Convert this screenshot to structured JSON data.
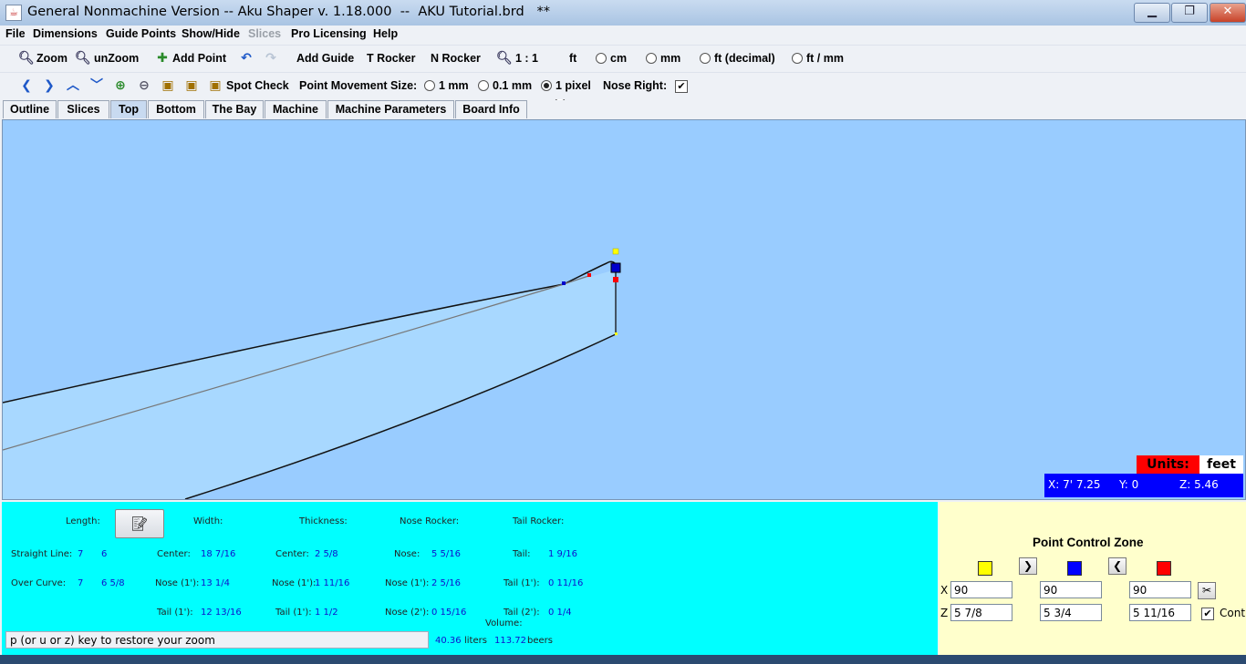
{
  "window": {
    "title": "General Nonmachine Version -- Aku Shaper v. 1.18.000  --  AKU Tutorial.brd   **",
    "minimize": "▁",
    "restore": "❐",
    "close": "✕"
  },
  "menu": [
    "File",
    "Dimensions",
    "Guide Points",
    "Show/Hide",
    "Slices",
    "Pro Licensing",
    "Help"
  ],
  "toolbar1": {
    "zoom": "Zoom",
    "unzoom": "unZoom",
    "add_point": "Add Point",
    "add_guide": "Add Guide",
    "t_rocker": "T Rocker",
    "n_rocker": "N Rocker",
    "scale": "1 : 1",
    "units": [
      "ft",
      "cm",
      "mm",
      "ft (decimal)",
      "ft / mm"
    ],
    "selected_unit": "ft"
  },
  "toolbar2": {
    "spot_check": "Spot Check",
    "point_movement_label": "Point Movement Size:",
    "sizes": [
      "1 mm",
      "0.1 mm",
      "1 pixel"
    ],
    "selected_size": "1 pixel",
    "nose_right_label": "Nose Right:",
    "nose_right": true
  },
  "tabs": [
    "Outline",
    "Slices",
    "Top",
    "Bottom",
    "The Bay",
    "Machine",
    "Machine Parameters",
    "Board Info"
  ],
  "active_tab": "Top",
  "canvas": {
    "units_label": "Units:",
    "units_value": "feet",
    "coords": {
      "x": "X: 7' 7.25",
      "y": "Y: 0",
      "z": "Z: 5.46"
    },
    "colors": {
      "background": "#99ccff",
      "fill": "#a8d8ff",
      "yellow": "#ffff00",
      "blue": "#0000cc",
      "red": "#ff0000"
    }
  },
  "info": {
    "headers": {
      "length": "Length:",
      "width": "Width:",
      "thickness": "Thickness:",
      "nose_rocker": "Nose Rocker:",
      "tail_rocker": "Tail Rocker:"
    },
    "straight_line": {
      "label": "Straight Line:",
      "ft": "7",
      "in": "6"
    },
    "over_curve": {
      "label": "Over Curve:",
      "ft": "7",
      "in": "6 5/8"
    },
    "width": {
      "center_label": "Center:",
      "center": "18 7/16",
      "nose1_label": "Nose (1'):",
      "nose1": "13 1/4",
      "tail1_label": "Tail (1'):",
      "tail1": "12 13/16"
    },
    "thickness": {
      "center_label": "Center:",
      "center": "2 5/8",
      "nose1_label": "Nose (1'):",
      "nose1": "1 11/16",
      "tail1_label": "Tail (1'):",
      "tail1": "1 1/2"
    },
    "nose_rocker": {
      "nose_label": "Nose:",
      "nose": "5 5/16",
      "nose1_label": "Nose (1'):",
      "nose1": "2 5/16",
      "nose2_label": "Nose (2'):",
      "nose2": "0 15/16"
    },
    "tail_rocker": {
      "tail_label": "Tail:",
      "tail": "1 9/16",
      "tail1_label": "Tail (1'):",
      "tail1": "0 11/16",
      "tail2_label": "Tail (2'):",
      "tail2": "0 1/4"
    },
    "volume_label": "Volume:",
    "liters": "40.36",
    "liters_label": "liters",
    "beers": "113.72",
    "beers_label": "beers",
    "status": "p (or u or z) key to restore your zoom"
  },
  "point_control": {
    "title": "Point Control Zone",
    "x_label": "X",
    "z_label": "Z",
    "x_values": [
      "90",
      "90",
      "90"
    ],
    "z_values": [
      "5 7/8",
      "5 3/4",
      "5 11/16"
    ],
    "cont_label": "Cont",
    "cont_checked": true
  }
}
